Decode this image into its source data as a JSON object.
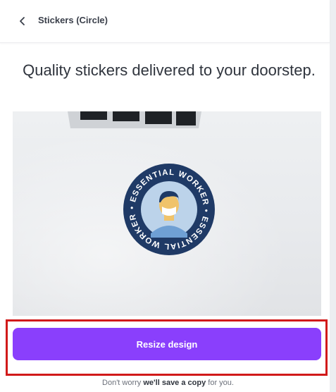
{
  "header": {
    "title": "Stickers (Circle)"
  },
  "headline": "Quality stickers delivered to your doorstep.",
  "sticker": {
    "ring_text": "• ESSENTIAL WORKER • ESSENTIAL WORKER"
  },
  "cta": {
    "label": "Resize design"
  },
  "footnote": {
    "part1": "Don't worry ",
    "bold": "we'll save a copy",
    "part2": " for you."
  },
  "colors": {
    "accent": "#8a3ffc",
    "highlight": "#d11a1a",
    "sticker_ring": "#1f3a66"
  },
  "icons": {
    "back": "chevron-left-icon"
  }
}
